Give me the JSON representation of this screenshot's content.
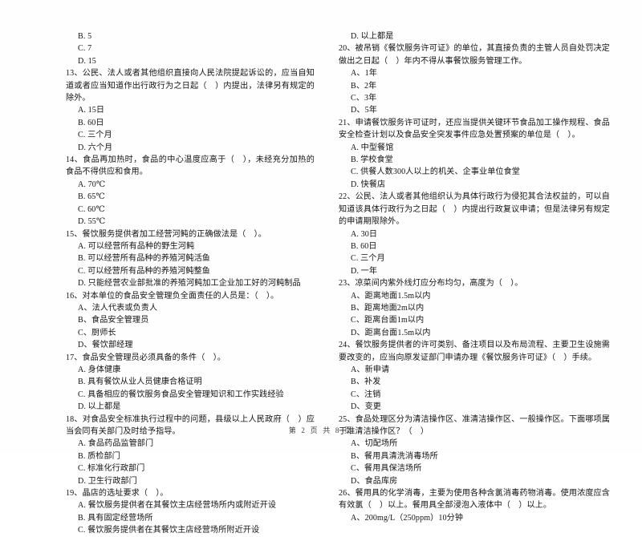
{
  "document": {
    "footer": "第 2 页 共 8 页",
    "page_number": "2",
    "total_pages": "8"
  },
  "left_column": {
    "orphan_options": [
      "B. 5",
      "C. 7",
      "D. 15"
    ],
    "questions": [
      {
        "number": "13",
        "stem": "13、公民、法人或者其他组织直接向人民法院提起诉讼的，应当自知道或者应当知道作出行政行为之日起（　）内提出，法律另有规定的除外。",
        "options": [
          "A. 15日",
          "B. 60日",
          "C. 三个月",
          "D. 六个月"
        ]
      },
      {
        "number": "14",
        "stem": "14、食品再加热时，食品的中心温度应高于（　），未经充分加热的食品不得供应和食用。",
        "options": [
          "A. 70℃",
          "B. 65℃",
          "C. 60℃",
          "D. 55℃"
        ]
      },
      {
        "number": "15",
        "stem": "15、餐饮服务提供者加工经营河鲀的正确做法是（　）。",
        "options": [
          "A. 可以经营所有品种的野生河鲀",
          "B. 可以经营所有品种的养殖河鲀活鱼",
          "C. 可以经营所有品种的养殖河鲀整鱼",
          "D. 只能经营农业部批准的养殖河鲀加工企业加工好的河鲀制品"
        ]
      },
      {
        "number": "16",
        "stem": "16、对本单位的食品安全管理负全面责任的人员是：（　）。",
        "options": [
          "A、法人代表或负责人",
          "B、食品安全管理员",
          "C、厨师长",
          "D、餐饮部经理"
        ]
      },
      {
        "number": "17",
        "stem": "17、食品安全管理员必须具备的条件（　）。",
        "options": [
          "A. 身体健康",
          "B. 具有餐饮从业人员健康合格证明",
          "C. 具备相应的餐饮服务食品安全管理知识和工作实践经验",
          "D. 以上都是"
        ]
      },
      {
        "number": "18",
        "stem": "18、对食品安全标准执行过程中的问题，县级以上人民政府（　）应当会同有关部门及时给予指导。",
        "options": [
          "A. 食品药品监管部门",
          "B. 质检部门",
          "C. 标准化行政部门",
          "D. 卫生行政部门"
        ]
      },
      {
        "number": "19",
        "stem": "19、晶店的选址要求（　）。",
        "options": [
          "A. 餐饮服务提供者在其餐饮主店经营场所内或附近开设",
          "B. 具有固定经营场所",
          "C. 餐饮服务提供者在其餐饮主店经营场所附近开设"
        ]
      }
    ]
  },
  "right_column": {
    "orphan_options": [
      "D. 以上都是"
    ],
    "questions": [
      {
        "number": "20",
        "stem": "20、被吊销《餐饮服务许可证》的单位，其直接负责的主管人员自处罚决定做出之日起（　）年内不得从事餐饮服务管理工作。",
        "options": [
          "A、1年",
          "B、2年",
          "C、3年",
          "D、5年"
        ]
      },
      {
        "number": "21",
        "stem": "21、申请餐饮服务许可证时，还应当提供关键环节食品加工操作规程、食品安全检查计划以及食品安全突发事件应急处置预案的单位是（　）。",
        "options": [
          "A. 中型餐馆",
          "B. 学校食堂",
          "C. 供餐人数300人以上的机关、企事业单位食堂",
          "D. 快餐店"
        ]
      },
      {
        "number": "22",
        "stem": "22、公民、法人或者其他组织认为具体行政行为侵犯其合法权益的，可以自知道该具体行政行为之日起（　）内提出行政复议申请；但是法律另有规定的申请期限除外。",
        "options": [
          "A. 30日",
          "B. 60日",
          "C. 三个月",
          "D. 一年"
        ]
      },
      {
        "number": "23",
        "stem": "23、凉菜间内紫外线灯应分布均匀，高度为（　）。",
        "options": [
          "A、距离地面1.5m以内",
          "B、距离地面2m以内",
          "C、距离台面1m以内",
          "D、距离台面1.5m以内"
        ]
      },
      {
        "number": "24",
        "stem": "24、餐饮服务提供者的许可类别、备注项目以及布局流程、主要卫生设施需要改变的，应当向原发证部门申请办理《餐饮服务许可证》（　）手续。",
        "options": [
          "A、新申请",
          "B、补发",
          "C、注销",
          "D、变更"
        ]
      },
      {
        "number": "25",
        "stem": "25、食品处理区分为清洁操作区、准清洁操作区、一般操作区。下面哪项属于准清洁操作区？（　）",
        "options": [
          "A、切配场所",
          "B、餐用具清洗消毒场所",
          "C、餐用具保洁场所",
          "D、食品库房"
        ]
      },
      {
        "number": "26",
        "stem": "26、餐用具的化学消毒，主要为使用各种含氯消毒药物消毒。使用浓度应含有效氯（　）以上。餐用具全部浸泡入液体中（　）以上。",
        "options": [
          "A、200mg/L（250ppm）10分钟"
        ]
      }
    ]
  }
}
